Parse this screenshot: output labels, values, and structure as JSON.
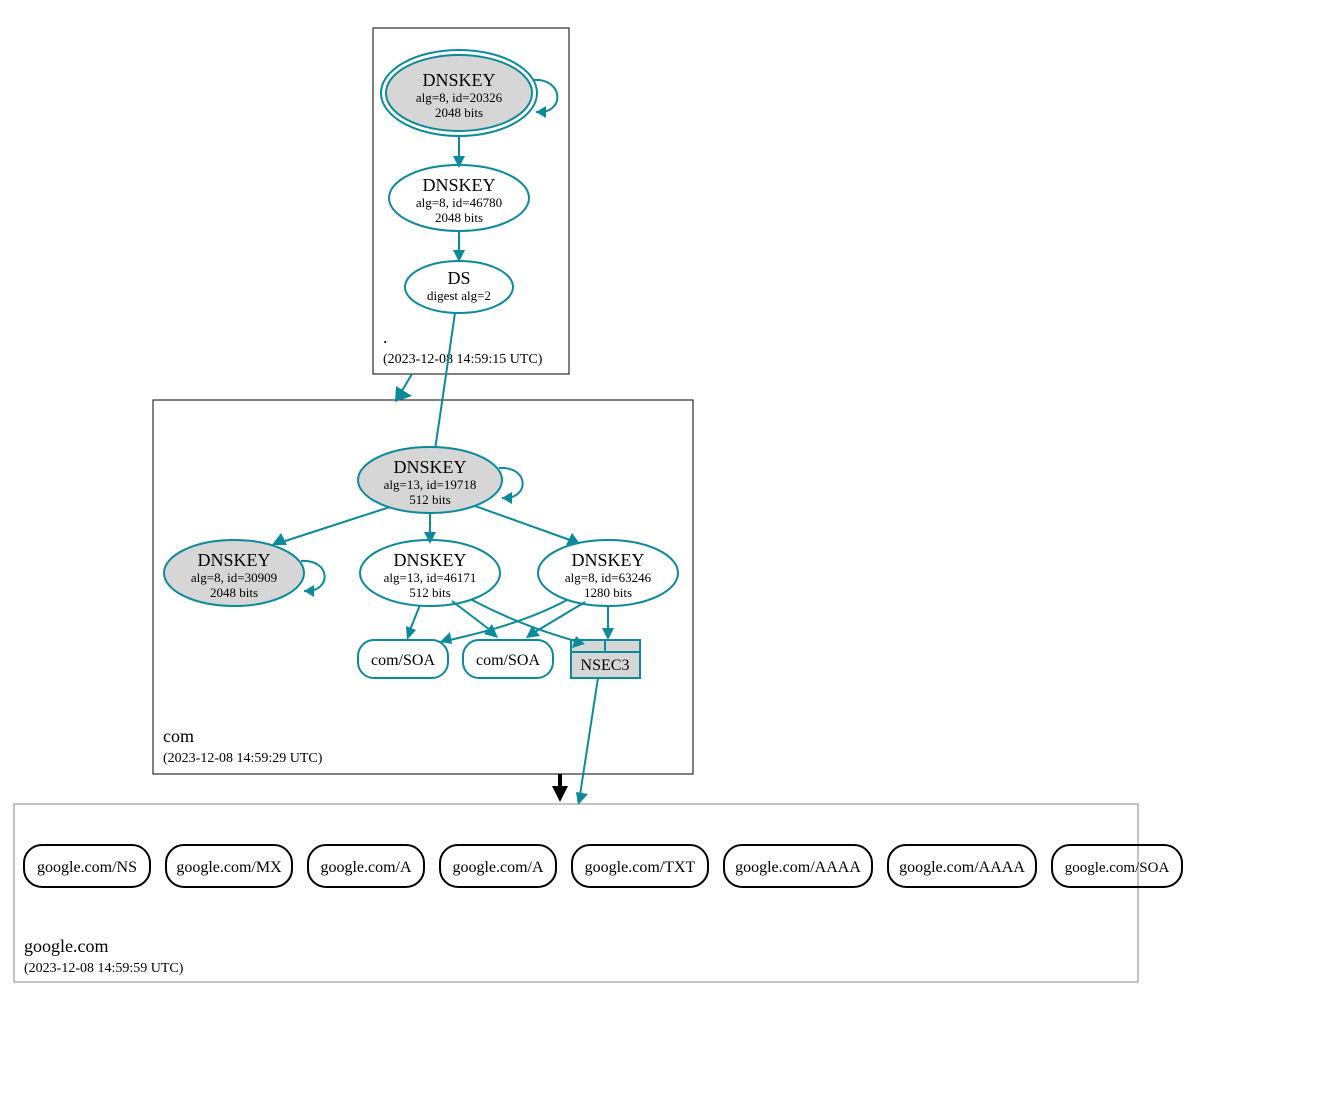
{
  "colors": {
    "teal": "#0b8a9b",
    "grey_fill": "#d6d6d6"
  },
  "zones": {
    "root": {
      "label": ".",
      "timestamp": "(2023-12-08 14:59:15 UTC)"
    },
    "com": {
      "label": "com",
      "timestamp": "(2023-12-08 14:59:29 UTC)"
    },
    "google": {
      "label": "google.com",
      "timestamp": "(2023-12-08 14:59:59 UTC)"
    }
  },
  "nodes": {
    "root_ksk": {
      "title": "DNSKEY",
      "line2": "alg=8, id=20326",
      "line3": "2048 bits"
    },
    "root_zsk": {
      "title": "DNSKEY",
      "line2": "alg=8, id=46780",
      "line3": "2048 bits"
    },
    "root_ds": {
      "title": "DS",
      "line2": "digest alg=2"
    },
    "com_ksk": {
      "title": "DNSKEY",
      "line2": "alg=13, id=19718",
      "line3": "512 bits"
    },
    "com_k2": {
      "title": "DNSKEY",
      "line2": "alg=8, id=30909",
      "line3": "2048 bits"
    },
    "com_k3": {
      "title": "DNSKEY",
      "line2": "alg=13, id=46171",
      "line3": "512 bits"
    },
    "com_k4": {
      "title": "DNSKEY",
      "line2": "alg=8, id=63246",
      "line3": "1280 bits"
    },
    "com_soa1": {
      "label": "com/SOA"
    },
    "com_soa2": {
      "label": "com/SOA"
    },
    "nsec3": {
      "label": "NSEC3"
    },
    "g_ns": {
      "label": "google.com/NS"
    },
    "g_mx": {
      "label": "google.com/MX"
    },
    "g_a1": {
      "label": "google.com/A"
    },
    "g_a2": {
      "label": "google.com/A"
    },
    "g_txt": {
      "label": "google.com/TXT"
    },
    "g_aaaa1": {
      "label": "google.com/AAAA"
    },
    "g_aaaa2": {
      "label": "google.com/AAAA"
    },
    "g_soa": {
      "label": "google.com/SOA"
    }
  },
  "chart_data": {
    "type": "graph",
    "description": "DNSSEC authentication chain / dnsviz-style diagram",
    "zones": [
      {
        "name": ".",
        "timestamp": "2023-12-08 14:59:15 UTC",
        "nodes": [
          {
            "id": "root_ksk",
            "type": "DNSKEY",
            "alg": 8,
            "key_id": 20326,
            "bits": 2048,
            "ksk": true,
            "self_signed": true
          },
          {
            "id": "root_zsk",
            "type": "DNSKEY",
            "alg": 8,
            "key_id": 46780,
            "bits": 2048
          },
          {
            "id": "root_ds",
            "type": "DS",
            "digest_alg": 2
          }
        ]
      },
      {
        "name": "com",
        "timestamp": "2023-12-08 14:59:29 UTC",
        "nodes": [
          {
            "id": "com_ksk",
            "type": "DNSKEY",
            "alg": 13,
            "key_id": 19718,
            "bits": 512,
            "ksk": true,
            "self_signed": true
          },
          {
            "id": "com_k2",
            "type": "DNSKEY",
            "alg": 8,
            "key_id": 30909,
            "bits": 2048,
            "self_signed": true
          },
          {
            "id": "com_k3",
            "type": "DNSKEY",
            "alg": 13,
            "key_id": 46171,
            "bits": 512
          },
          {
            "id": "com_k4",
            "type": "DNSKEY",
            "alg": 8,
            "key_id": 63246,
            "bits": 1280
          },
          {
            "id": "com_soa1",
            "type": "RRset",
            "name": "com/SOA"
          },
          {
            "id": "com_soa2",
            "type": "RRset",
            "name": "com/SOA"
          },
          {
            "id": "nsec3",
            "type": "NSEC3"
          }
        ]
      },
      {
        "name": "google.com",
        "timestamp": "2023-12-08 14:59:59 UTC",
        "nodes": [
          {
            "id": "g_ns",
            "type": "RRset",
            "name": "google.com/NS"
          },
          {
            "id": "g_mx",
            "type": "RRset",
            "name": "google.com/MX"
          },
          {
            "id": "g_a1",
            "type": "RRset",
            "name": "google.com/A"
          },
          {
            "id": "g_a2",
            "type": "RRset",
            "name": "google.com/A"
          },
          {
            "id": "g_txt",
            "type": "RRset",
            "name": "google.com/TXT"
          },
          {
            "id": "g_aaaa1",
            "type": "RRset",
            "name": "google.com/AAAA"
          },
          {
            "id": "g_aaaa2",
            "type": "RRset",
            "name": "google.com/AAAA"
          },
          {
            "id": "g_soa",
            "type": "RRset",
            "name": "google.com/SOA"
          }
        ]
      }
    ],
    "edges": [
      {
        "from": "root_ksk",
        "to": "root_ksk",
        "kind": "self-loop"
      },
      {
        "from": "root_ksk",
        "to": "root_zsk"
      },
      {
        "from": "root_zsk",
        "to": "root_ds"
      },
      {
        "from": "root_ds",
        "to": "com_ksk"
      },
      {
        "from": "root_zone",
        "to": "com_zone",
        "kind": "zone-delegation"
      },
      {
        "from": "com_ksk",
        "to": "com_ksk",
        "kind": "self-loop"
      },
      {
        "from": "com_ksk",
        "to": "com_k2"
      },
      {
        "from": "com_ksk",
        "to": "com_k3"
      },
      {
        "from": "com_ksk",
        "to": "com_k4"
      },
      {
        "from": "com_k2",
        "to": "com_k2",
        "kind": "self-loop"
      },
      {
        "from": "com_k3",
        "to": "com_soa1"
      },
      {
        "from": "com_k3",
        "to": "com_soa2"
      },
      {
        "from": "com_k3",
        "to": "nsec3"
      },
      {
        "from": "com_k4",
        "to": "com_soa1"
      },
      {
        "from": "com_k4",
        "to": "com_soa2"
      },
      {
        "from": "com_k4",
        "to": "nsec3"
      },
      {
        "from": "nsec3",
        "to": "google_zone"
      },
      {
        "from": "com_zone",
        "to": "google_zone",
        "kind": "zone-delegation"
      }
    ]
  }
}
